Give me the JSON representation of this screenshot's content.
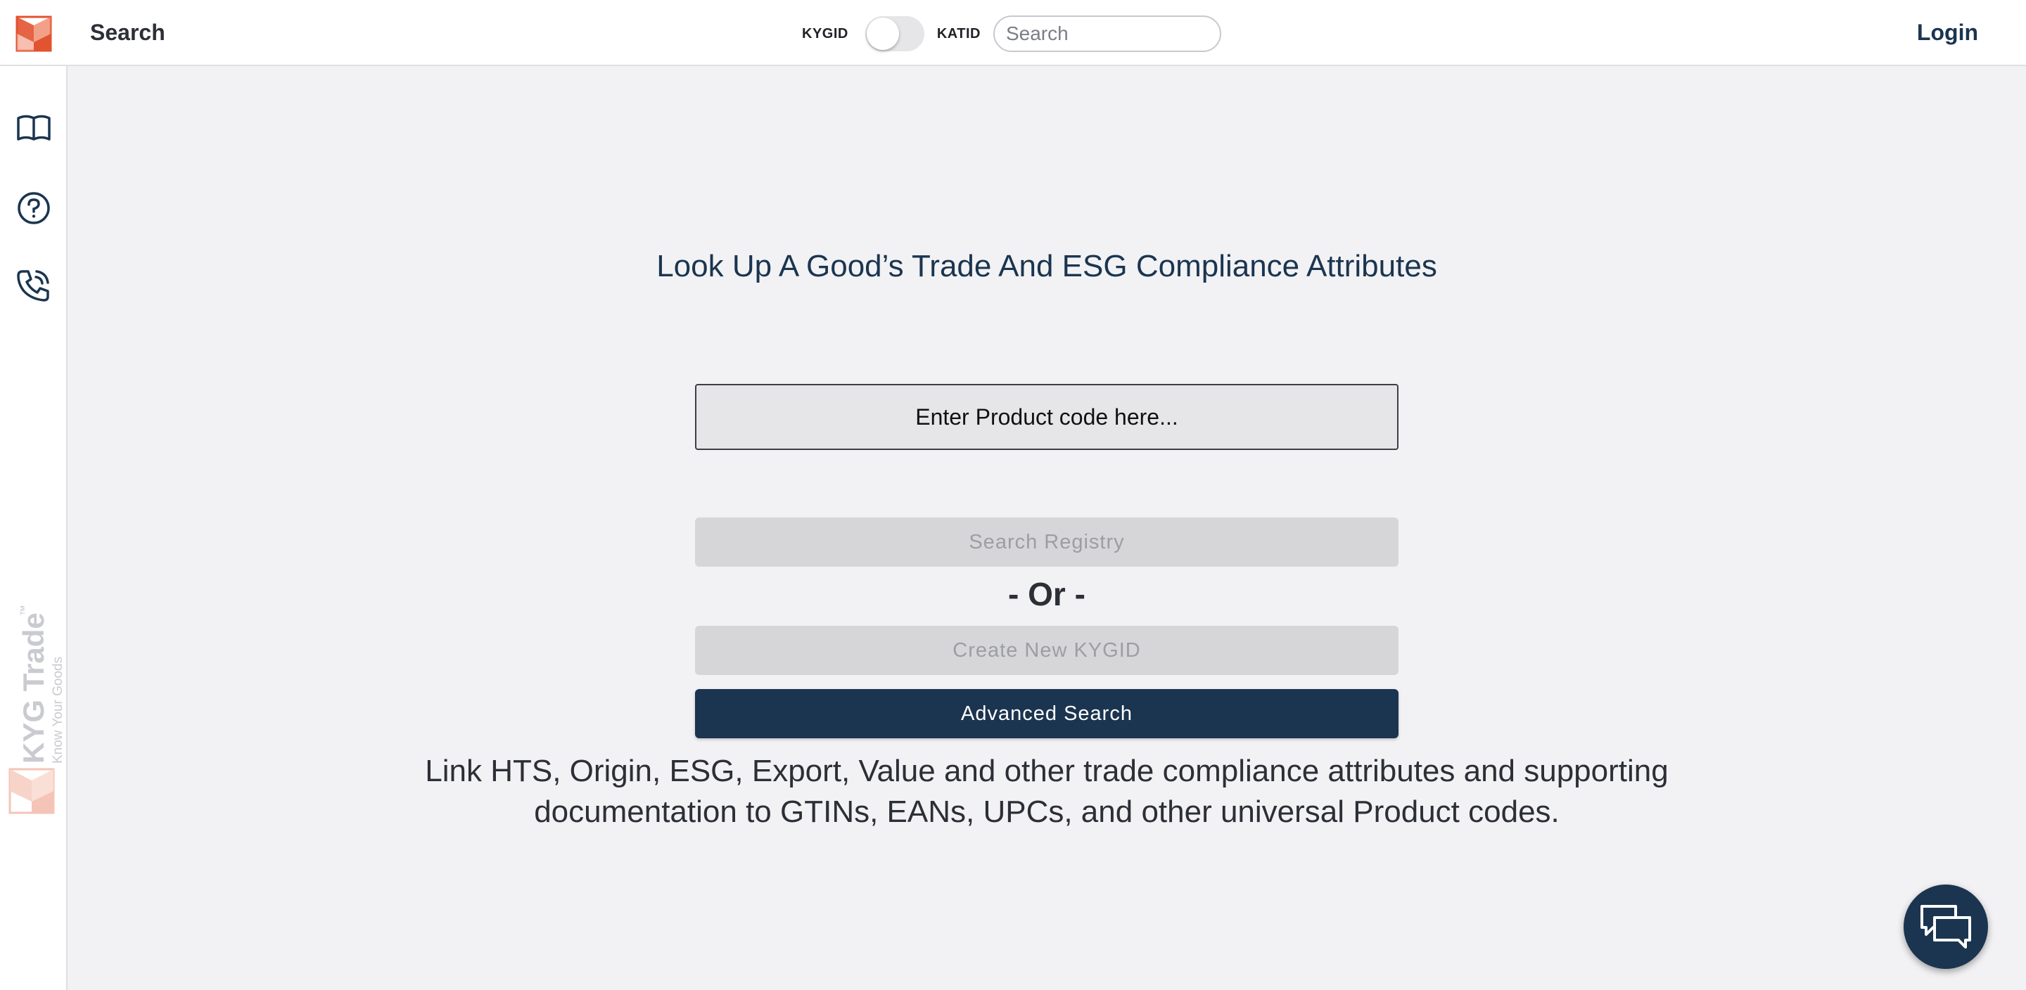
{
  "header": {
    "title": "Search",
    "toggle_left_label": "KYGID",
    "toggle_right_label": "KATID",
    "search_placeholder": "Search",
    "login_label": "Login"
  },
  "sidebar": {
    "items": [
      {
        "icon": "book-open-icon"
      },
      {
        "icon": "help-circle-icon"
      },
      {
        "icon": "phone-call-icon"
      }
    ],
    "brand_name": "KYG Trade",
    "brand_tm": "™",
    "brand_tagline": "Know Your Goods"
  },
  "main": {
    "headline": "Look Up A Good’s Trade And ESG Compliance Attributes",
    "product_placeholder": "Enter Product code here...",
    "search_registry_label": "Search Registry",
    "or_label": "- Or -",
    "create_kygid_label": "Create New KYGID",
    "advanced_search_label": "Advanced Search",
    "description": "Link HTS, Origin, ESG, Export, Value and other trade compliance attributes and supporting documentation to GTINs, EANs, UPCs, and other universal Product codes."
  },
  "colors": {
    "brand_navy": "#1b3550",
    "brand_orange": "#e2532f",
    "background": "#f2f2f4"
  }
}
